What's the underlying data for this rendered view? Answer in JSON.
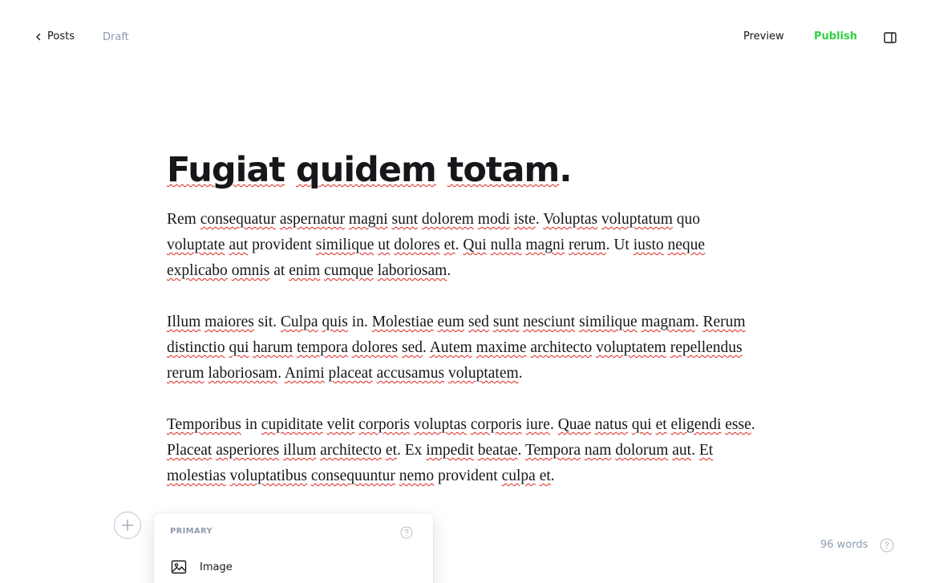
{
  "topbar": {
    "back_label": "Posts",
    "status": "Draft",
    "preview_label": "Preview",
    "publish_label": "Publish"
  },
  "post": {
    "title_words": [
      "Fugiat",
      "quidem",
      "totam."
    ],
    "paragraphs": [
      [
        {
          "t": "Rem",
          "s": false
        },
        {
          "t": "consequatur",
          "s": true
        },
        {
          "t": "aspernatur",
          "s": true
        },
        {
          "t": "magni",
          "s": true
        },
        {
          "t": "sunt",
          "s": true
        },
        {
          "t": "dolorem",
          "s": true
        },
        {
          "t": "modi",
          "s": true
        },
        {
          "t": "iste",
          "s": true,
          "p": "."
        },
        {
          "t": "Voluptas",
          "s": true
        },
        {
          "t": "voluptatum",
          "s": true
        },
        {
          "t": "quo",
          "s": false
        },
        {
          "t": "voluptate",
          "s": true
        },
        {
          "t": "aut",
          "s": true
        },
        {
          "t": "provident",
          "s": false
        },
        {
          "t": "similique",
          "s": true
        },
        {
          "t": "ut",
          "s": true
        },
        {
          "t": "dolores",
          "s": true
        },
        {
          "t": "et",
          "s": true,
          "p": "."
        },
        {
          "t": "Qui",
          "s": true
        },
        {
          "t": "nulla",
          "s": true
        },
        {
          "t": "magni",
          "s": true
        },
        {
          "t": "rerum",
          "s": true,
          "p": "."
        },
        {
          "t": "Ut",
          "s": false
        },
        {
          "t": "iusto",
          "s": true
        },
        {
          "t": "neque",
          "s": true
        },
        {
          "t": "explicabo",
          "s": true
        },
        {
          "t": "omnis",
          "s": true
        },
        {
          "t": "at",
          "s": false
        },
        {
          "t": "enim",
          "s": true
        },
        {
          "t": "cumque",
          "s": true
        },
        {
          "t": "laboriosam",
          "s": true,
          "p": "."
        }
      ],
      [
        {
          "t": "Illum",
          "s": true
        },
        {
          "t": "maiores",
          "s": true
        },
        {
          "t": "sit.",
          "s": false
        },
        {
          "t": "Culpa",
          "s": true
        },
        {
          "t": "quis",
          "s": true
        },
        {
          "t": "in.",
          "s": false
        },
        {
          "t": "Molestiae",
          "s": true
        },
        {
          "t": "eum",
          "s": true
        },
        {
          "t": "sed",
          "s": true
        },
        {
          "t": "sunt",
          "s": true
        },
        {
          "t": "nesciunt",
          "s": true
        },
        {
          "t": "similique",
          "s": true
        },
        {
          "t": "magnam",
          "s": true,
          "p": "."
        },
        {
          "t": "Rerum",
          "s": true
        },
        {
          "t": "distinctio",
          "s": true
        },
        {
          "t": "qui",
          "s": true
        },
        {
          "t": "harum",
          "s": true
        },
        {
          "t": "tempora",
          "s": true
        },
        {
          "t": "dolores",
          "s": true
        },
        {
          "t": "sed",
          "s": true,
          "p": "."
        },
        {
          "t": "Autem",
          "s": true
        },
        {
          "t": "maxime",
          "s": true
        },
        {
          "t": "architecto",
          "s": true
        },
        {
          "t": "voluptatem",
          "s": true
        },
        {
          "t": "repellendus",
          "s": true
        },
        {
          "t": "rerum",
          "s": true
        },
        {
          "t": "laboriosam",
          "s": true,
          "p": "."
        },
        {
          "t": "Animi",
          "s": true
        },
        {
          "t": "placeat",
          "s": true
        },
        {
          "t": "accusamus",
          "s": true
        },
        {
          "t": "voluptatem",
          "s": true,
          "p": "."
        }
      ],
      [
        {
          "t": "Temporibus",
          "s": true
        },
        {
          "t": "in",
          "s": false
        },
        {
          "t": "cupiditate",
          "s": true
        },
        {
          "t": "velit",
          "s": true
        },
        {
          "t": "corporis",
          "s": true
        },
        {
          "t": "voluptas",
          "s": true
        },
        {
          "t": "corporis",
          "s": true
        },
        {
          "t": "iure",
          "s": true,
          "p": "."
        },
        {
          "t": "Quae",
          "s": true
        },
        {
          "t": "natus",
          "s": true
        },
        {
          "t": "qui",
          "s": true
        },
        {
          "t": "et",
          "s": true
        },
        {
          "t": "eligendi",
          "s": true
        },
        {
          "t": "esse",
          "s": true,
          "p": "."
        },
        {
          "t": "Placeat",
          "s": true
        },
        {
          "t": "asperiores",
          "s": true
        },
        {
          "t": "illum",
          "s": true
        },
        {
          "t": "architecto",
          "s": true
        },
        {
          "t": "et",
          "s": true,
          "p": "."
        },
        {
          "t": "Ex",
          "s": false
        },
        {
          "t": "impedit",
          "s": true
        },
        {
          "t": "beatae",
          "s": true,
          "p": "."
        },
        {
          "t": "Tempora",
          "s": true
        },
        {
          "t": "nam",
          "s": true
        },
        {
          "t": "dolorum",
          "s": true
        },
        {
          "t": "aut",
          "s": true,
          "p": "."
        },
        {
          "t": "Et",
          "s": true
        },
        {
          "t": "molestias",
          "s": true
        },
        {
          "t": "voluptatibus",
          "s": true
        },
        {
          "t": "consequuntur",
          "s": true
        },
        {
          "t": "nemo",
          "s": true
        },
        {
          "t": "provident",
          "s": false
        },
        {
          "t": "culpa",
          "s": true
        },
        {
          "t": "et",
          "s": true,
          "p": "."
        }
      ]
    ]
  },
  "card_menu": {
    "section_label": "PRIMARY",
    "items": [
      {
        "label": "Image",
        "icon": "image-icon"
      }
    ]
  },
  "footer": {
    "word_count": "96 words"
  },
  "colors": {
    "accent": "#30cf43",
    "text": "#15171a",
    "muted": "#8e9cac",
    "spellcheck": "#e0251e"
  }
}
